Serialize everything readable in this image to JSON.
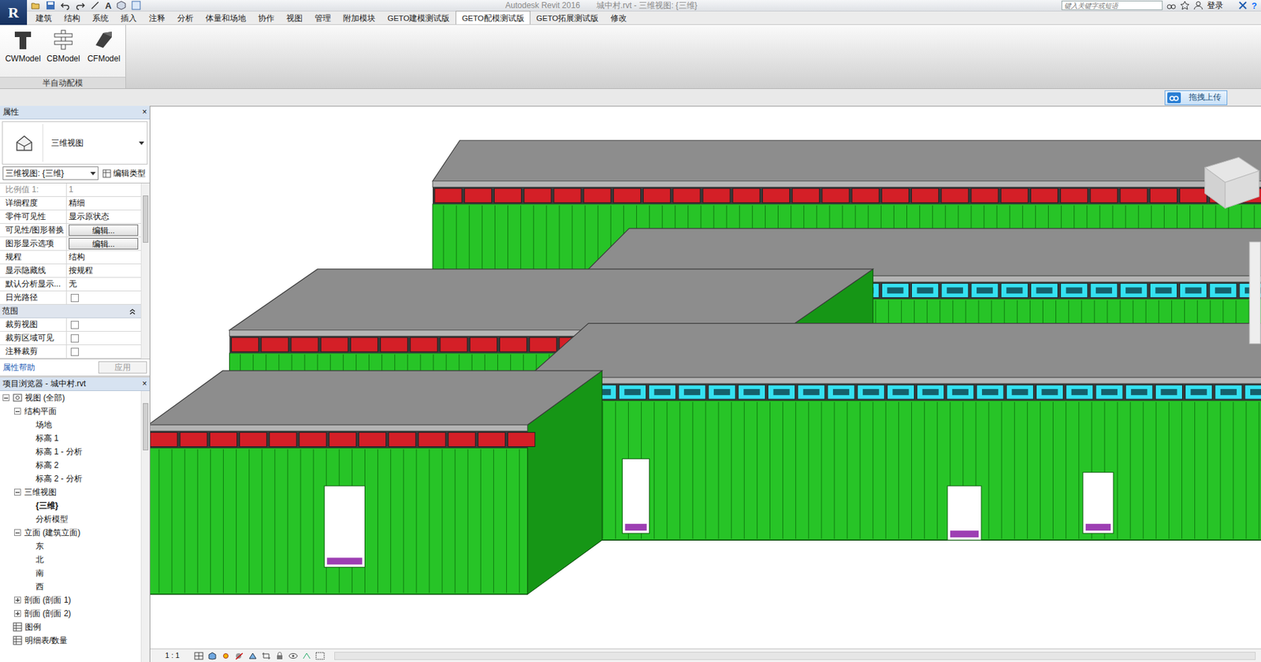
{
  "window": {
    "app": "Autodesk Revit 2016",
    "title": "城中村.rvt - 三维视图: {三维}"
  },
  "logo": "R",
  "annotate_glyph": "A",
  "search": {
    "placeholder": "键入关键字或短语"
  },
  "account": {
    "label": "登录"
  },
  "help": "?",
  "ribbon_tabs": [
    {
      "label": "建筑",
      "selected": false
    },
    {
      "label": "结构",
      "selected": false
    },
    {
      "label": "系统",
      "selected": false
    },
    {
      "label": "插入",
      "selected": false
    },
    {
      "label": "注释",
      "selected": false
    },
    {
      "label": "分析",
      "selected": false
    },
    {
      "label": "体量和场地",
      "selected": false
    },
    {
      "label": "协作",
      "selected": false
    },
    {
      "label": "视图",
      "selected": false
    },
    {
      "label": "管理",
      "selected": false
    },
    {
      "label": "附加模块",
      "selected": false
    },
    {
      "label": "GETO建模测试版",
      "selected": false
    },
    {
      "label": "GETO配模测试版",
      "selected": true
    },
    {
      "label": "GETO拓展测试版",
      "selected": false
    },
    {
      "label": "修改",
      "selected": false
    }
  ],
  "ribbon_buttons": [
    {
      "label": "CWModel"
    },
    {
      "label": "CBModel"
    },
    {
      "label": "CFModel"
    }
  ],
  "ribbon_panel": "半自动配模",
  "upload_button": "拖拽上传",
  "properties": {
    "title": "属性",
    "close": "×",
    "type": "三维视图",
    "view_select": "三维视图: {三维}",
    "edit_type": "编辑类型",
    "rows": [
      {
        "kind": "text",
        "label": "比例值 1:",
        "value": "1",
        "disabled": true
      },
      {
        "kind": "text",
        "label": "详细程度",
        "value": "精细",
        "disabled": false
      },
      {
        "kind": "text",
        "label": "零件可见性",
        "value": "显示原状态",
        "disabled": false
      },
      {
        "kind": "button",
        "label": "可见性/图形替换",
        "value": "编辑...",
        "disabled": false
      },
      {
        "kind": "button",
        "label": "图形显示选项",
        "value": "编辑...",
        "disabled": false
      },
      {
        "kind": "text",
        "label": "规程",
        "value": "结构",
        "disabled": false
      },
      {
        "kind": "text",
        "label": "显示隐藏线",
        "value": "按规程",
        "disabled": false
      },
      {
        "kind": "text",
        "label": "默认分析显示...",
        "value": "无",
        "disabled": false
      },
      {
        "kind": "check",
        "label": "日光路径",
        "checked": false,
        "disabled": false
      },
      {
        "kind": "section",
        "label": "范围",
        "expanded": true
      },
      {
        "kind": "check",
        "label": "裁剪视图",
        "checked": false,
        "disabled": false
      },
      {
        "kind": "check",
        "label": "裁剪区域可见",
        "checked": false,
        "disabled": false
      },
      {
        "kind": "check",
        "label": "注释裁剪",
        "checked": false,
        "disabled": false
      }
    ],
    "help": "属性帮助",
    "apply": "应用",
    "apply_disabled": true
  },
  "browser": {
    "title": "项目浏览器 - 城中村.rvt",
    "close": "×",
    "tree": [
      {
        "label": "视图 (全部)",
        "level": 0,
        "kind": "node",
        "expanded": true,
        "current": false
      },
      {
        "label": "结构平面",
        "level": 1,
        "kind": "node",
        "expanded": true,
        "current": false
      },
      {
        "label": "场地",
        "level": 2,
        "kind": "leaf",
        "expanded": false,
        "current": false
      },
      {
        "label": "标高 1",
        "level": 2,
        "kind": "leaf",
        "expanded": false,
        "current": false
      },
      {
        "label": "标高 1 - 分析",
        "level": 2,
        "kind": "leaf",
        "expanded": false,
        "current": false
      },
      {
        "label": "标高 2",
        "level": 2,
        "kind": "leaf",
        "expanded": false,
        "current": false
      },
      {
        "label": "标高 2 - 分析",
        "level": 2,
        "kind": "leaf",
        "expanded": false,
        "current": false
      },
      {
        "label": "三维视图",
        "level": 1,
        "kind": "node",
        "expanded": true,
        "current": false
      },
      {
        "label": "{三维}",
        "level": 2,
        "kind": "leaf",
        "expanded": false,
        "current": true
      },
      {
        "label": "分析模型",
        "level": 2,
        "kind": "leaf",
        "expanded": false,
        "current": false
      },
      {
        "label": "立面 (建筑立面)",
        "level": 1,
        "kind": "node",
        "expanded": true,
        "current": false
      },
      {
        "label": "东",
        "level": 2,
        "kind": "leaf",
        "expanded": false,
        "current": false
      },
      {
        "label": "北",
        "level": 2,
        "kind": "leaf",
        "expanded": false,
        "current": false
      },
      {
        "label": "南",
        "level": 2,
        "kind": "leaf",
        "expanded": false,
        "current": false
      },
      {
        "label": "西",
        "level": 2,
        "kind": "leaf",
        "expanded": false,
        "current": false
      },
      {
        "label": "剖面 (剖面 1)",
        "level": 1,
        "kind": "node",
        "expanded": false,
        "current": false
      },
      {
        "label": "剖面 (剖面 2)",
        "level": 1,
        "kind": "node",
        "expanded": false,
        "current": false
      },
      {
        "label": "图例",
        "level": 0,
        "kind": "icon",
        "expanded": false,
        "current": false
      },
      {
        "label": "明细表/数量",
        "level": 0,
        "kind": "icon",
        "expanded": false,
        "current": false
      }
    ]
  },
  "status_bar": {
    "scale": "1 : 1"
  }
}
